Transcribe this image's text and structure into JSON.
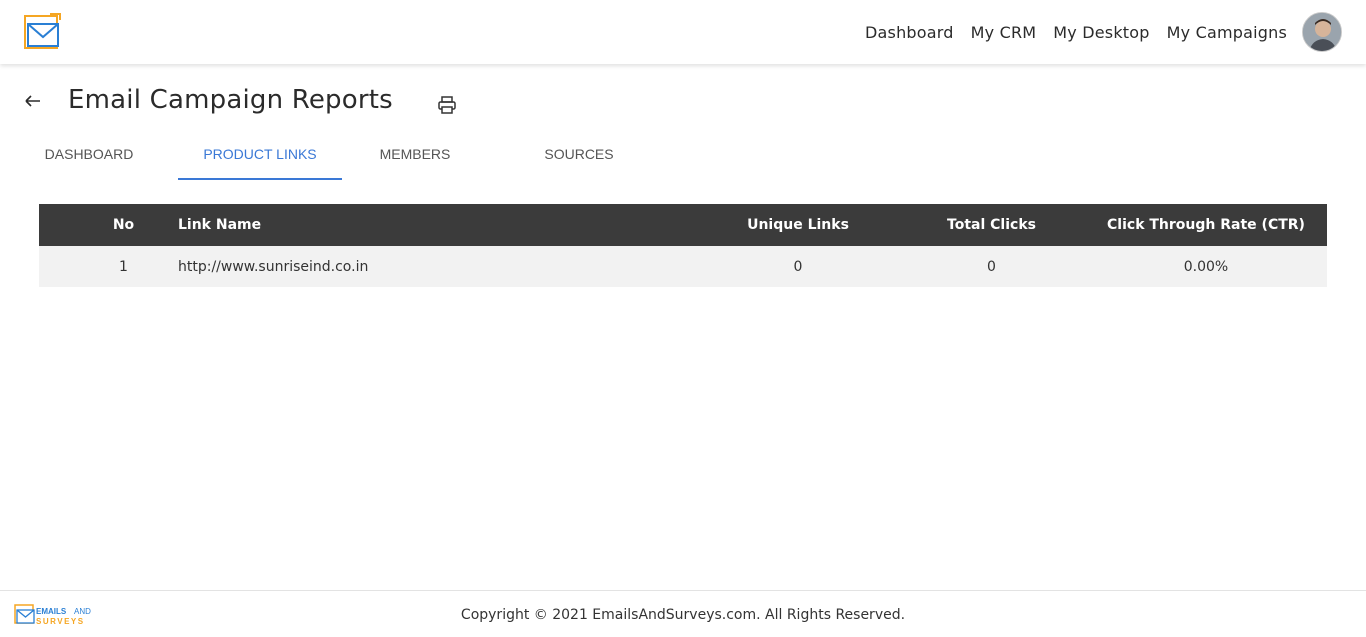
{
  "header": {
    "nav": [
      "Dashboard",
      "My CRM",
      "My Desktop",
      "My Campaigns"
    ]
  },
  "page": {
    "title": "Email Campaign Reports"
  },
  "tabs": [
    {
      "label": "DASHBOARD",
      "active": false
    },
    {
      "label": "PRODUCT LINKS",
      "active": true
    },
    {
      "label": "MEMBERS",
      "active": false
    },
    {
      "label": "SOURCES",
      "active": false
    }
  ],
  "table": {
    "headers": [
      "No",
      "Link Name",
      "Unique Links",
      "Total Clicks",
      "Click Through Rate (CTR)"
    ],
    "rows": [
      [
        "1",
        "http://www.sunriseind.co.in",
        "0",
        "0",
        "0.00%"
      ]
    ]
  },
  "footer": {
    "logo_text_1": "EMAILS",
    "logo_text_2": "AND",
    "logo_text_3": "SURVEYS",
    "copyright": "Copyright © 2021 EmailsAndSurveys.com. All Rights Reserved."
  },
  "colors": {
    "accent": "#3a78d6",
    "header_bg": "#3b3b3b",
    "row_bg": "#f2f2f2",
    "logo_orange": "#f5a623",
    "logo_blue": "#2a7fd4"
  },
  "icons": {
    "logo": "envelope-logo-icon",
    "back": "arrow-left-icon",
    "print": "printer-icon",
    "avatar": "user-avatar"
  }
}
